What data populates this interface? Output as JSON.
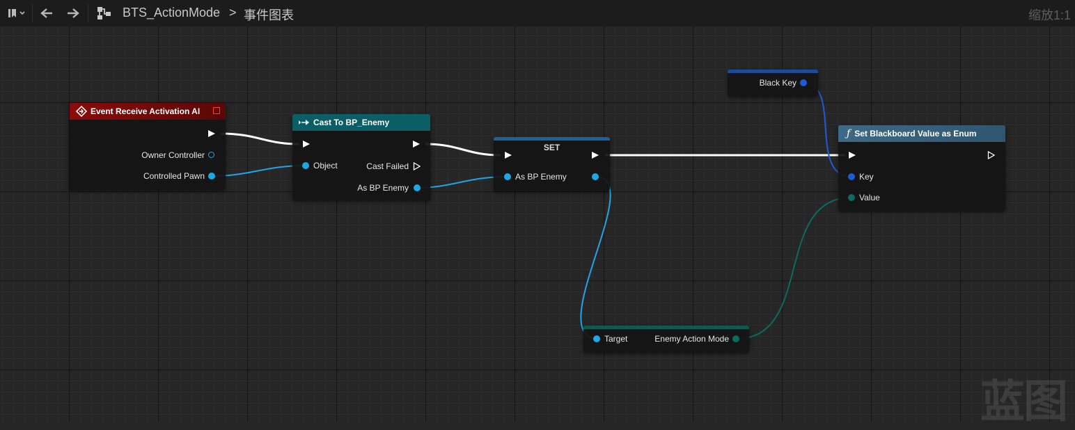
{
  "toolbar": {
    "bookmark_icon": "bookmark-icon",
    "back_icon": "arrow-left-icon",
    "forward_icon": "arrow-right-icon",
    "asset_icon": "blueprint-graph-icon",
    "asset_name": "BTS_ActionMode",
    "breadcrumb_separator": ">",
    "graph_name": "事件图表",
    "zoom": "缩放1:1"
  },
  "nodes": {
    "event": {
      "title": "Event Receive Activation AI",
      "pins": {
        "owner_controller": "Owner Controller",
        "controlled_pawn": "Controlled Pawn"
      }
    },
    "cast": {
      "title": "Cast To BP_Enemy",
      "pins": {
        "object": "Object",
        "cast_failed": "Cast Failed",
        "as_bp_enemy": "As BP Enemy"
      }
    },
    "set": {
      "title": "SET",
      "pins": {
        "as_bp_enemy": "As BP Enemy"
      }
    },
    "black_key": {
      "pins": {
        "black_key": "Black Key"
      }
    },
    "set_blackboard": {
      "title": "Set Blackboard Value as Enum",
      "pins": {
        "key": "Key",
        "value": "Value"
      }
    },
    "get_action_mode": {
      "pins": {
        "target": "Target",
        "enemy_action_mode": "Enemy Action Mode"
      }
    }
  },
  "watermark": "蓝图",
  "colors": {
    "event_header": "#8b0b0b",
    "cast_header": "#0c5e66",
    "set_header": "#1f5f9a",
    "function_header": "#3d6a86",
    "object_pin": "#1ea7e8",
    "blackboard_key_pin": "#1e5bd6",
    "enum_pin": "#0c6b5e",
    "exec_wire": "#ffffff"
  }
}
